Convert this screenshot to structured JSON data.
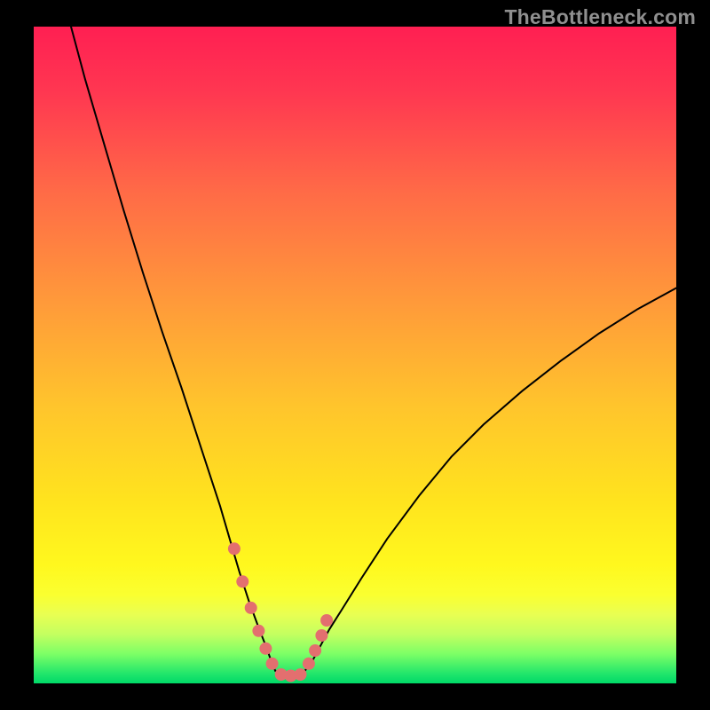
{
  "watermark": "TheBottleneck.com",
  "chart_data": {
    "type": "line",
    "title": "",
    "xlabel": "",
    "ylabel": "",
    "xlim": [
      0,
      100
    ],
    "ylim": [
      0,
      100
    ],
    "grid": false,
    "legend": false,
    "background_gradient": {
      "top": "#ff2550",
      "mid": "#ffd400",
      "bottom": "#00e060"
    },
    "series": [
      {
        "name": "curve-left",
        "x": [
          5.8,
          8,
          11,
          14,
          17,
          20,
          23,
          26,
          29,
          30.5,
          32,
          33.5,
          35,
          36.2,
          37,
          37.6
        ],
        "y": [
          100,
          92,
          82,
          72,
          62.5,
          53.5,
          45,
          36,
          27,
          22,
          17,
          12.5,
          8.5,
          5.5,
          3.3,
          1.9
        ]
      },
      {
        "name": "curve-right",
        "x": [
          42.2,
          43.3,
          44.5,
          46,
          48,
          51,
          55,
          60,
          65,
          70,
          76,
          82,
          88,
          94,
          100
        ],
        "y": [
          1.9,
          3.3,
          5.5,
          8.2,
          11.3,
          16,
          22,
          28.6,
          34.5,
          39.4,
          44.5,
          49.1,
          53.3,
          57,
          60.2
        ]
      },
      {
        "name": "valley-floor",
        "x": [
          37.6,
          38.5,
          40,
          41.5,
          42.2
        ],
        "y": [
          1.9,
          1.35,
          1.15,
          1.35,
          1.9
        ]
      }
    ],
    "marker_points": {
      "name": "salmon-dots",
      "color": "#e36f6f",
      "radius_px": 7,
      "x": [
        31.2,
        32.5,
        33.8,
        35.0,
        36.1,
        37.1,
        38.5,
        40.0,
        41.5,
        42.8,
        43.8,
        44.8,
        45.6
      ],
      "y": [
        20.5,
        15.5,
        11.5,
        8.0,
        5.3,
        3.0,
        1.35,
        1.15,
        1.35,
        3.0,
        5.0,
        7.3,
        9.6
      ]
    }
  }
}
